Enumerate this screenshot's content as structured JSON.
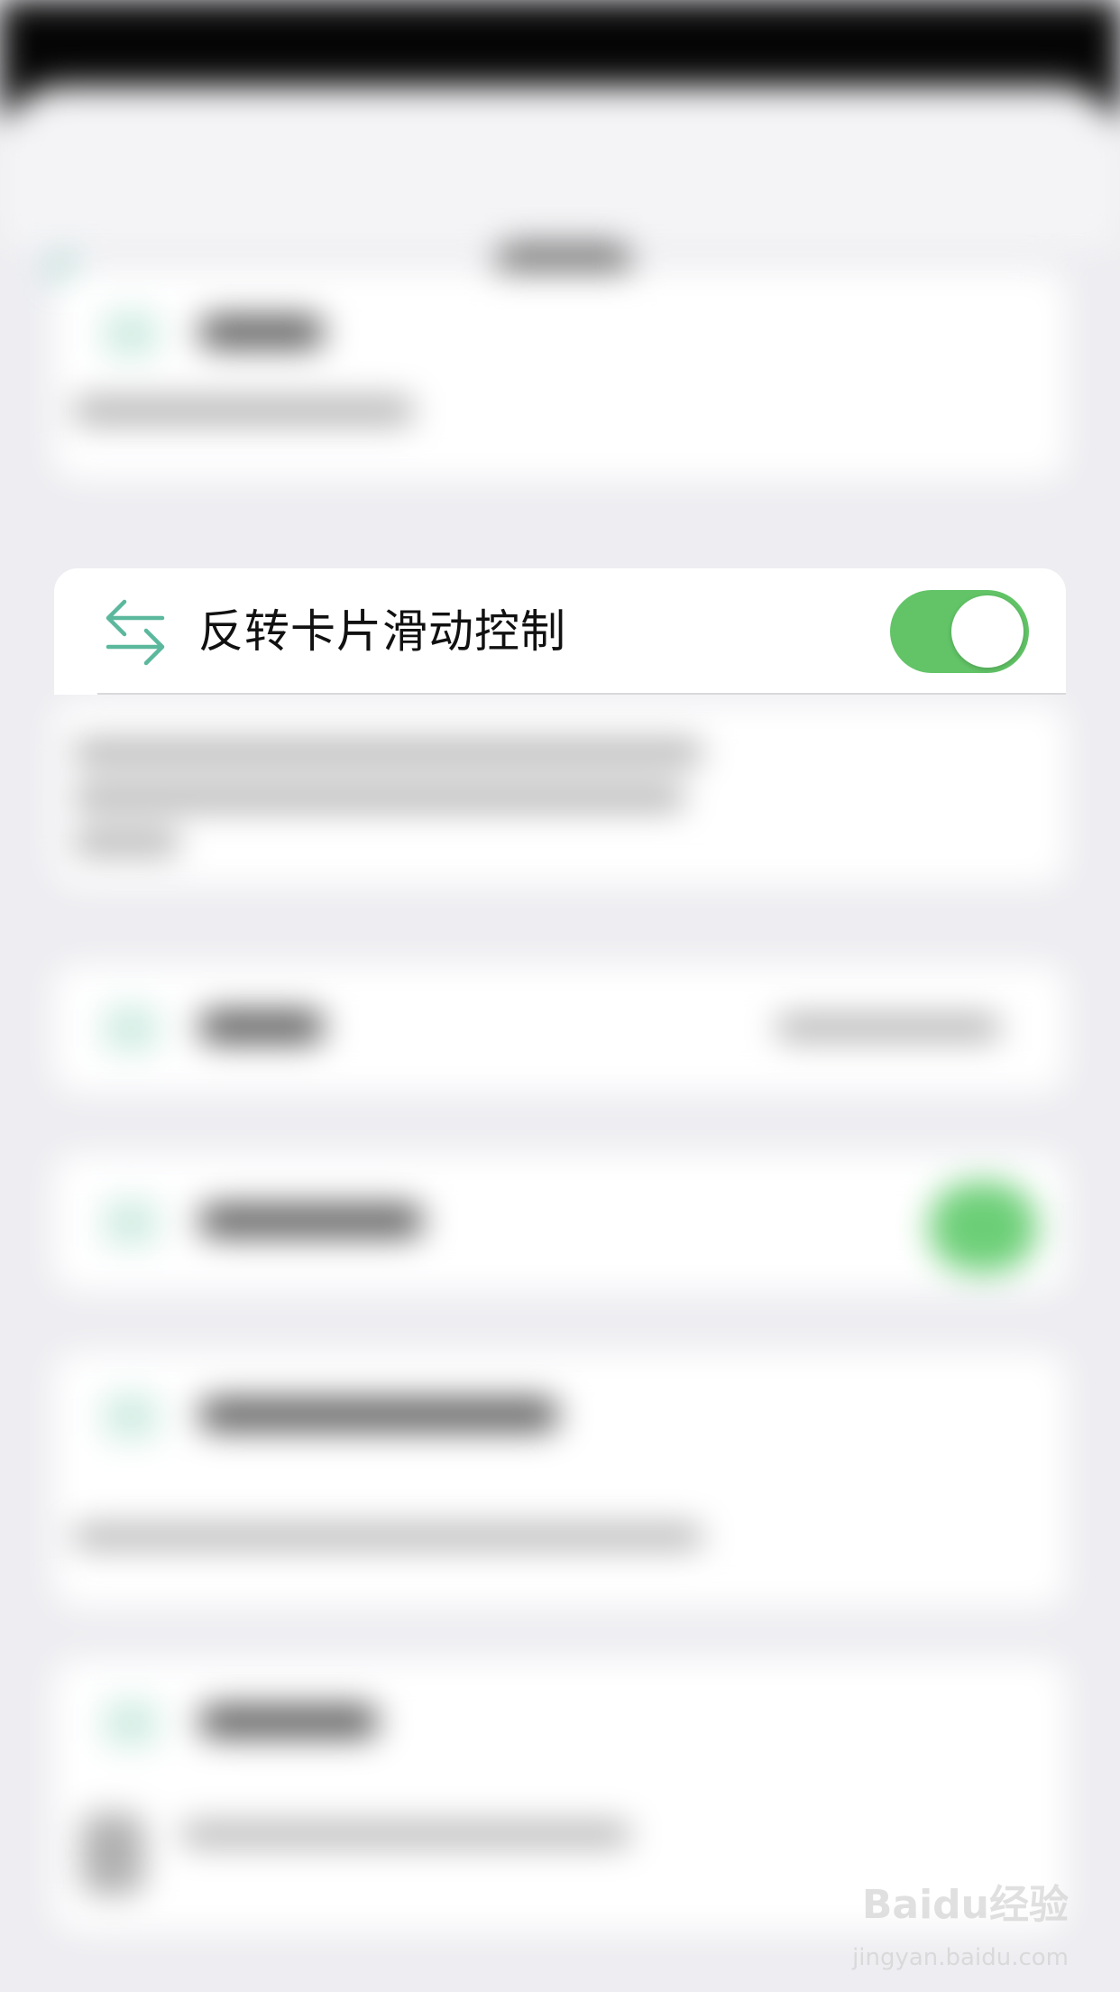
{
  "setting": {
    "label": "反转卡片滑动控制",
    "icon": "swap-arrows-icon",
    "enabled": true
  },
  "colors": {
    "accent_green": "#62c467",
    "icon_teal": "#5bb89d"
  },
  "watermark": {
    "logo": "Baidu经验",
    "url": "jingyan.baidu.com"
  }
}
